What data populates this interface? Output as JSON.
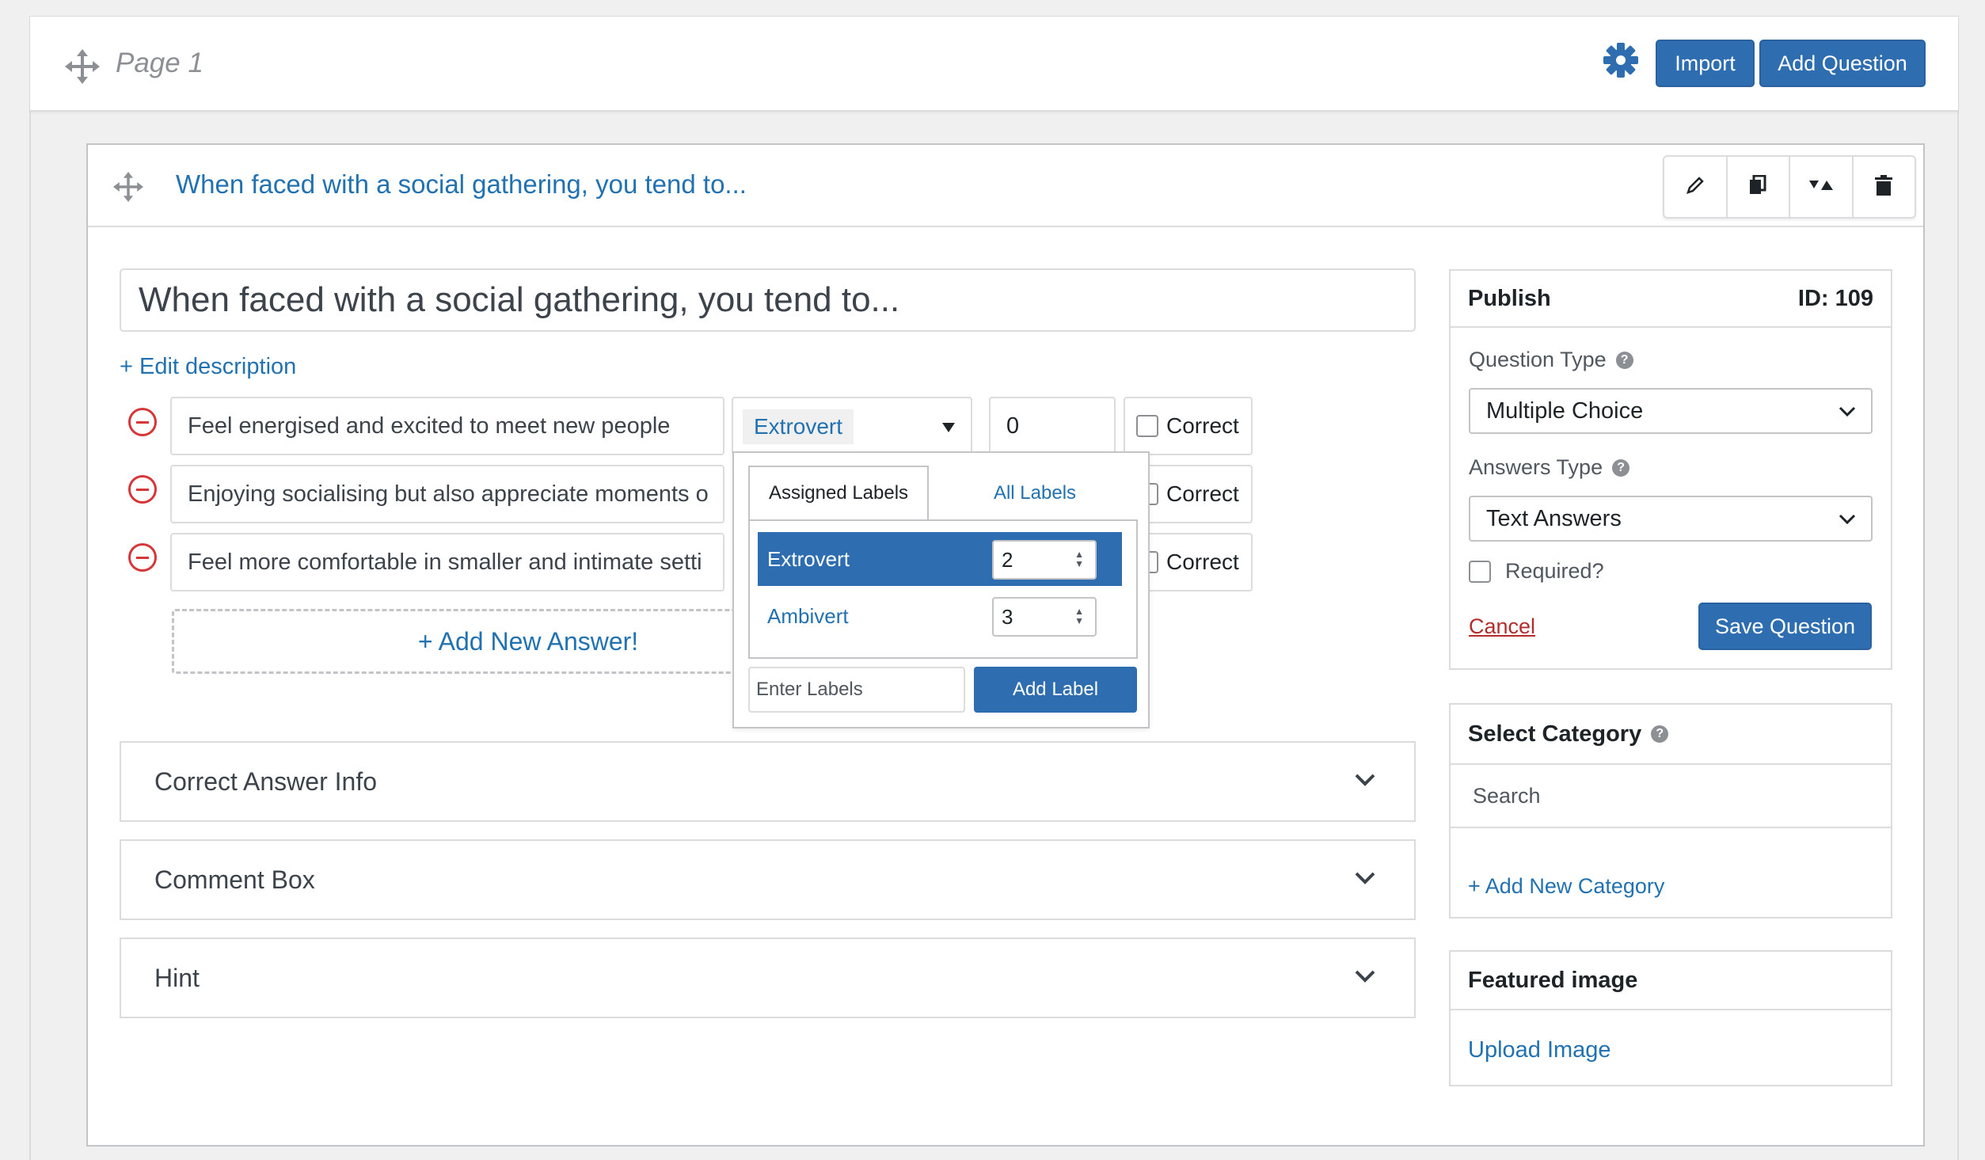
{
  "page": {
    "title": "Page 1",
    "import_label": "Import",
    "add_question_label": "Add Question"
  },
  "question": {
    "header_title": "When faced with a social gathering, you tend to...",
    "title_value": "When faced with a social gathering, you tend to...",
    "edit_description": "+ Edit description",
    "answers": [
      {
        "text": "Feel energised and excited to meet new people",
        "correct_label": "Correct"
      },
      {
        "text": "Enjoying socialising but also appreciate moments o",
        "correct_label": "Correct"
      },
      {
        "text": "Feel more comfortable in smaller and intimate setti",
        "correct_label": "Correct"
      }
    ],
    "first_answer_label": "Extrovert",
    "first_answer_points": "0",
    "add_answer": "+ Add New Answer!"
  },
  "label_dropdown": {
    "tab_assigned": "Assigned Labels",
    "tab_all": "All Labels",
    "labels": [
      {
        "name": "Extrovert",
        "value": "2"
      },
      {
        "name": "Ambivert",
        "value": "3"
      }
    ],
    "input_placeholder": "Enter Labels",
    "add_button": "Add Label"
  },
  "accordions": [
    "Correct Answer Info",
    "Comment Box",
    "Hint"
  ],
  "publish": {
    "heading": "Publish",
    "id_label": "ID: 109",
    "question_type_label": "Question Type",
    "question_type_value": "Multiple Choice",
    "answers_type_label": "Answers Type",
    "answers_type_value": "Text Answers",
    "required_label": "Required?",
    "cancel_label": "Cancel",
    "save_label": "Save Question"
  },
  "category": {
    "heading": "Select Category",
    "search_placeholder": "Search",
    "add_new": "+ Add New Category"
  },
  "featured_image": {
    "heading": "Featured image",
    "upload_label": "Upload Image"
  },
  "colors": {
    "accent": "#2e6db0",
    "link": "#2271b1",
    "danger": "#d63638",
    "gear": "#2e6db0"
  },
  "icons": [
    "move-icon",
    "gear-icon",
    "pencil-icon",
    "duplicate-icon",
    "collapse-icon",
    "trash-icon",
    "remove-answer-icon",
    "chevron-down-icon",
    "help-icon"
  ]
}
